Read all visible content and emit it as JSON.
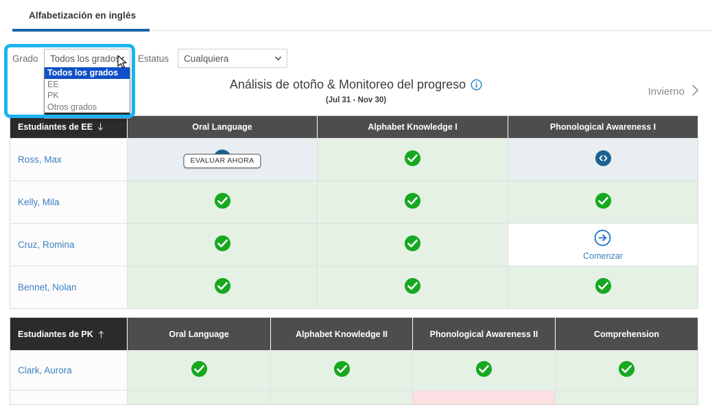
{
  "tab": {
    "label": "Alfabetización en inglés"
  },
  "filters": {
    "grade": {
      "label": "Grado",
      "value": "Todos los grados",
      "caret_icon": "chevron-down-icon",
      "options": [
        "Todos los grados",
        "EE",
        "PK",
        "Otros grados"
      ],
      "selected_index": 0
    },
    "status": {
      "label": "Estatus",
      "value": "Cualquiera",
      "caret_icon": "chevron-down-icon"
    }
  },
  "report": {
    "title": "Análisis de otoño & Monitoreo del progreso",
    "info_icon": "info-circle-icon",
    "date_range": "(Jul 31 - Nov 30)",
    "next_season": "Invierno",
    "next_icon": "chevron-right-icon"
  },
  "colors": {
    "accent_blue": "#1565a8",
    "focus_cyan": "#19b5ef",
    "header_dark": "#4d4d4d",
    "name_header_dark": "#2b2b2b",
    "complete_green": "#16a81f",
    "in_progress_blue": "#1b6291",
    "link_blue": "#3d7fc1",
    "cell_green": "#e4f1e4",
    "cell_blue": "#e8eef1",
    "cell_pink": "#fbdfe2"
  },
  "tables": [
    {
      "id": "ee",
      "name_header": {
        "label": "Estudiantes de EE",
        "sort_icon": "arrow-down-icon"
      },
      "columns": [
        "Oral Language",
        "Alphabet Knowledge I",
        "Phonological Awareness I"
      ],
      "rows": [
        {
          "student": "Ross, Max",
          "cells": [
            {
              "bg": "blue",
              "icon": "assess-now-dot",
              "tooltip": "EVALUAR AHORA"
            },
            {
              "bg": "green",
              "icon": "check-circle-icon"
            },
            {
              "bg": "blue",
              "icon": "in-progress-icon"
            }
          ]
        },
        {
          "student": "Kelly, Mila",
          "cells": [
            {
              "bg": "green",
              "icon": "check-circle-icon"
            },
            {
              "bg": "green",
              "icon": "check-circle-icon"
            },
            {
              "bg": "green",
              "icon": "check-circle-icon"
            }
          ]
        },
        {
          "student": "Cruz, Romina",
          "cells": [
            {
              "bg": "green",
              "icon": "check-circle-icon"
            },
            {
              "bg": "green",
              "icon": "check-circle-icon"
            },
            {
              "bg": "white",
              "icon": "start-arrow-icon",
              "label": "Comenzar"
            }
          ]
        },
        {
          "student": "Bennet, Nolan",
          "cells": [
            {
              "bg": "green",
              "icon": "check-circle-icon"
            },
            {
              "bg": "green",
              "icon": "check-circle-icon"
            },
            {
              "bg": "green",
              "icon": "check-circle-icon"
            }
          ]
        }
      ]
    },
    {
      "id": "pk",
      "name_header": {
        "label": "Estudiantes de PK",
        "sort_icon": "arrow-up-icon"
      },
      "columns": [
        "Oral Language",
        "Alphabet Knowledge II",
        "Phonological Awareness II",
        "Comprehension"
      ],
      "rows": [
        {
          "student": "Clark, Aurora",
          "cells": [
            {
              "bg": "green",
              "icon": "check-circle-icon"
            },
            {
              "bg": "green",
              "icon": "check-circle-icon"
            },
            {
              "bg": "green",
              "icon": "check-circle-icon"
            },
            {
              "bg": "green",
              "icon": "check-circle-icon"
            }
          ]
        },
        {
          "student": "",
          "cells": [
            {
              "bg": "green",
              "icon": ""
            },
            {
              "bg": "green",
              "icon": ""
            },
            {
              "bg": "pink",
              "icon": ""
            },
            {
              "bg": "green",
              "icon": ""
            }
          ]
        }
      ]
    }
  ]
}
